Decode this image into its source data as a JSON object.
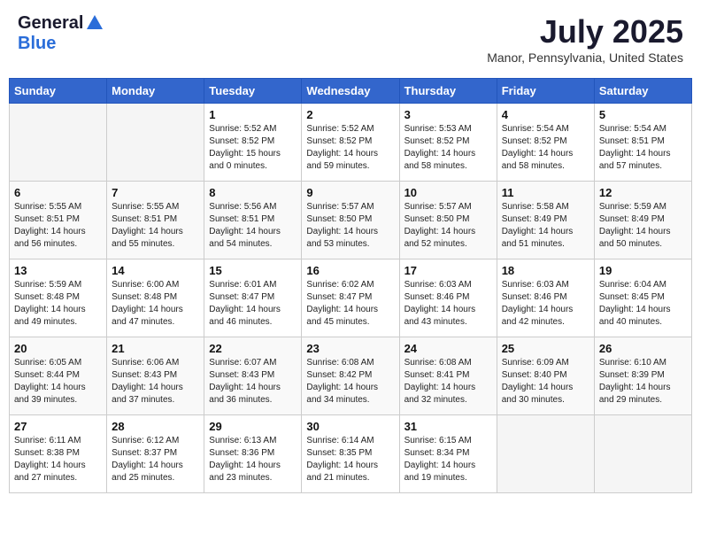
{
  "header": {
    "logo_general": "General",
    "logo_blue": "Blue",
    "title": "July 2025",
    "location": "Manor, Pennsylvania, United States"
  },
  "days_of_week": [
    "Sunday",
    "Monday",
    "Tuesday",
    "Wednesday",
    "Thursday",
    "Friday",
    "Saturday"
  ],
  "weeks": [
    [
      {
        "day": "",
        "info": ""
      },
      {
        "day": "",
        "info": ""
      },
      {
        "day": "1",
        "info": "Sunrise: 5:52 AM\nSunset: 8:52 PM\nDaylight: 15 hours\nand 0 minutes."
      },
      {
        "day": "2",
        "info": "Sunrise: 5:52 AM\nSunset: 8:52 PM\nDaylight: 14 hours\nand 59 minutes."
      },
      {
        "day": "3",
        "info": "Sunrise: 5:53 AM\nSunset: 8:52 PM\nDaylight: 14 hours\nand 58 minutes."
      },
      {
        "day": "4",
        "info": "Sunrise: 5:54 AM\nSunset: 8:52 PM\nDaylight: 14 hours\nand 58 minutes."
      },
      {
        "day": "5",
        "info": "Sunrise: 5:54 AM\nSunset: 8:51 PM\nDaylight: 14 hours\nand 57 minutes."
      }
    ],
    [
      {
        "day": "6",
        "info": "Sunrise: 5:55 AM\nSunset: 8:51 PM\nDaylight: 14 hours\nand 56 minutes."
      },
      {
        "day": "7",
        "info": "Sunrise: 5:55 AM\nSunset: 8:51 PM\nDaylight: 14 hours\nand 55 minutes."
      },
      {
        "day": "8",
        "info": "Sunrise: 5:56 AM\nSunset: 8:51 PM\nDaylight: 14 hours\nand 54 minutes."
      },
      {
        "day": "9",
        "info": "Sunrise: 5:57 AM\nSunset: 8:50 PM\nDaylight: 14 hours\nand 53 minutes."
      },
      {
        "day": "10",
        "info": "Sunrise: 5:57 AM\nSunset: 8:50 PM\nDaylight: 14 hours\nand 52 minutes."
      },
      {
        "day": "11",
        "info": "Sunrise: 5:58 AM\nSunset: 8:49 PM\nDaylight: 14 hours\nand 51 minutes."
      },
      {
        "day": "12",
        "info": "Sunrise: 5:59 AM\nSunset: 8:49 PM\nDaylight: 14 hours\nand 50 minutes."
      }
    ],
    [
      {
        "day": "13",
        "info": "Sunrise: 5:59 AM\nSunset: 8:48 PM\nDaylight: 14 hours\nand 49 minutes."
      },
      {
        "day": "14",
        "info": "Sunrise: 6:00 AM\nSunset: 8:48 PM\nDaylight: 14 hours\nand 47 minutes."
      },
      {
        "day": "15",
        "info": "Sunrise: 6:01 AM\nSunset: 8:47 PM\nDaylight: 14 hours\nand 46 minutes."
      },
      {
        "day": "16",
        "info": "Sunrise: 6:02 AM\nSunset: 8:47 PM\nDaylight: 14 hours\nand 45 minutes."
      },
      {
        "day": "17",
        "info": "Sunrise: 6:03 AM\nSunset: 8:46 PM\nDaylight: 14 hours\nand 43 minutes."
      },
      {
        "day": "18",
        "info": "Sunrise: 6:03 AM\nSunset: 8:46 PM\nDaylight: 14 hours\nand 42 minutes."
      },
      {
        "day": "19",
        "info": "Sunrise: 6:04 AM\nSunset: 8:45 PM\nDaylight: 14 hours\nand 40 minutes."
      }
    ],
    [
      {
        "day": "20",
        "info": "Sunrise: 6:05 AM\nSunset: 8:44 PM\nDaylight: 14 hours\nand 39 minutes."
      },
      {
        "day": "21",
        "info": "Sunrise: 6:06 AM\nSunset: 8:43 PM\nDaylight: 14 hours\nand 37 minutes."
      },
      {
        "day": "22",
        "info": "Sunrise: 6:07 AM\nSunset: 8:43 PM\nDaylight: 14 hours\nand 36 minutes."
      },
      {
        "day": "23",
        "info": "Sunrise: 6:08 AM\nSunset: 8:42 PM\nDaylight: 14 hours\nand 34 minutes."
      },
      {
        "day": "24",
        "info": "Sunrise: 6:08 AM\nSunset: 8:41 PM\nDaylight: 14 hours\nand 32 minutes."
      },
      {
        "day": "25",
        "info": "Sunrise: 6:09 AM\nSunset: 8:40 PM\nDaylight: 14 hours\nand 30 minutes."
      },
      {
        "day": "26",
        "info": "Sunrise: 6:10 AM\nSunset: 8:39 PM\nDaylight: 14 hours\nand 29 minutes."
      }
    ],
    [
      {
        "day": "27",
        "info": "Sunrise: 6:11 AM\nSunset: 8:38 PM\nDaylight: 14 hours\nand 27 minutes."
      },
      {
        "day": "28",
        "info": "Sunrise: 6:12 AM\nSunset: 8:37 PM\nDaylight: 14 hours\nand 25 minutes."
      },
      {
        "day": "29",
        "info": "Sunrise: 6:13 AM\nSunset: 8:36 PM\nDaylight: 14 hours\nand 23 minutes."
      },
      {
        "day": "30",
        "info": "Sunrise: 6:14 AM\nSunset: 8:35 PM\nDaylight: 14 hours\nand 21 minutes."
      },
      {
        "day": "31",
        "info": "Sunrise: 6:15 AM\nSunset: 8:34 PM\nDaylight: 14 hours\nand 19 minutes."
      },
      {
        "day": "",
        "info": ""
      },
      {
        "day": "",
        "info": ""
      }
    ]
  ]
}
